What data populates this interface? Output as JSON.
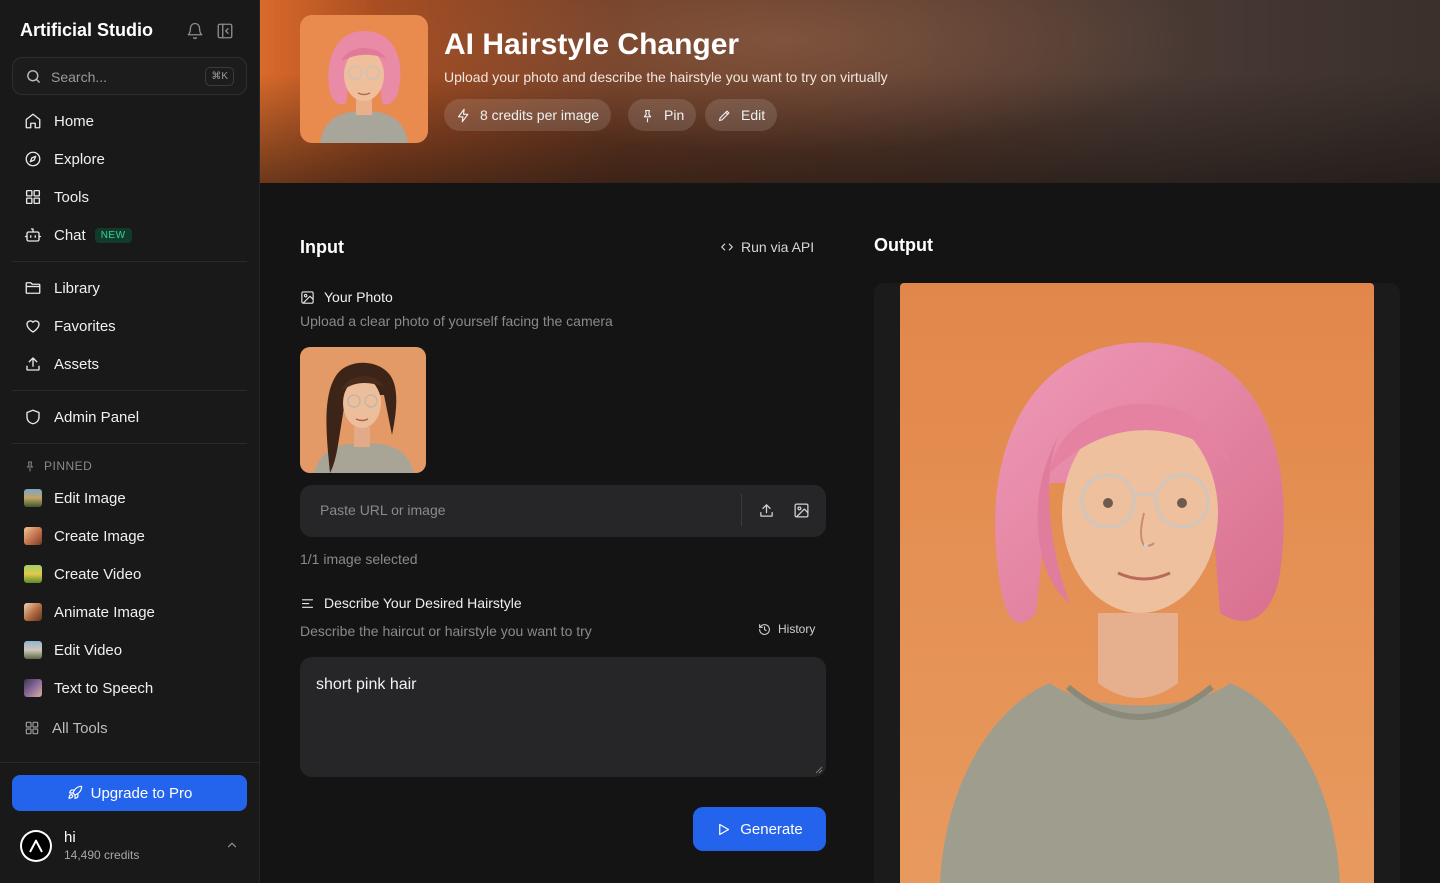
{
  "sidebar": {
    "brand": "Artificial Studio",
    "search": {
      "placeholder": "Search...",
      "shortcut": "⌘K"
    },
    "nav_main": [
      {
        "label": "Home",
        "icon": "home-icon"
      },
      {
        "label": "Explore",
        "icon": "compass-icon"
      },
      {
        "label": "Tools",
        "icon": "grid-icon"
      },
      {
        "label": "Chat",
        "icon": "bot-icon",
        "badge": "NEW"
      }
    ],
    "nav_library": [
      {
        "label": "Library",
        "icon": "folder-icon"
      },
      {
        "label": "Favorites",
        "icon": "heart-icon"
      },
      {
        "label": "Assets",
        "icon": "upload-icon"
      }
    ],
    "nav_admin": [
      {
        "label": "Admin Panel",
        "icon": "shield-icon"
      }
    ],
    "pinned_header": "PINNED",
    "pinned": [
      {
        "label": "Edit Image"
      },
      {
        "label": "Create Image"
      },
      {
        "label": "Create Video"
      },
      {
        "label": "Animate Image"
      },
      {
        "label": "Edit Video"
      },
      {
        "label": "Text to Speech"
      }
    ],
    "all_tools": "All Tools",
    "upgrade_label": "Upgrade to Pro",
    "user": {
      "name": "hi",
      "credits": "14,490 credits"
    }
  },
  "header": {
    "title": "AI Hairstyle Changer",
    "subtitle": "Upload your photo and describe the hairstyle you want to try on virtually",
    "chips": {
      "credits": "8 credits per image",
      "pin": "Pin",
      "edit": "Edit"
    }
  },
  "input": {
    "title": "Input",
    "api_link": "Run via API",
    "photo": {
      "label": "Your Photo",
      "help": "Upload a clear photo of yourself facing the camera",
      "url_placeholder": "Paste URL or image",
      "selected": "1/1 image selected"
    },
    "hairstyle": {
      "label": "Describe Your Desired Hairstyle",
      "help": "Describe the haircut or hairstyle you want to try",
      "history": "History",
      "value": "short pink hair"
    },
    "generate_label": "Generate"
  },
  "output": {
    "title": "Output"
  },
  "colors": {
    "accent": "#2463eb",
    "new_badge": "#34d399",
    "background": "#141414",
    "sidebar": "#191919"
  }
}
